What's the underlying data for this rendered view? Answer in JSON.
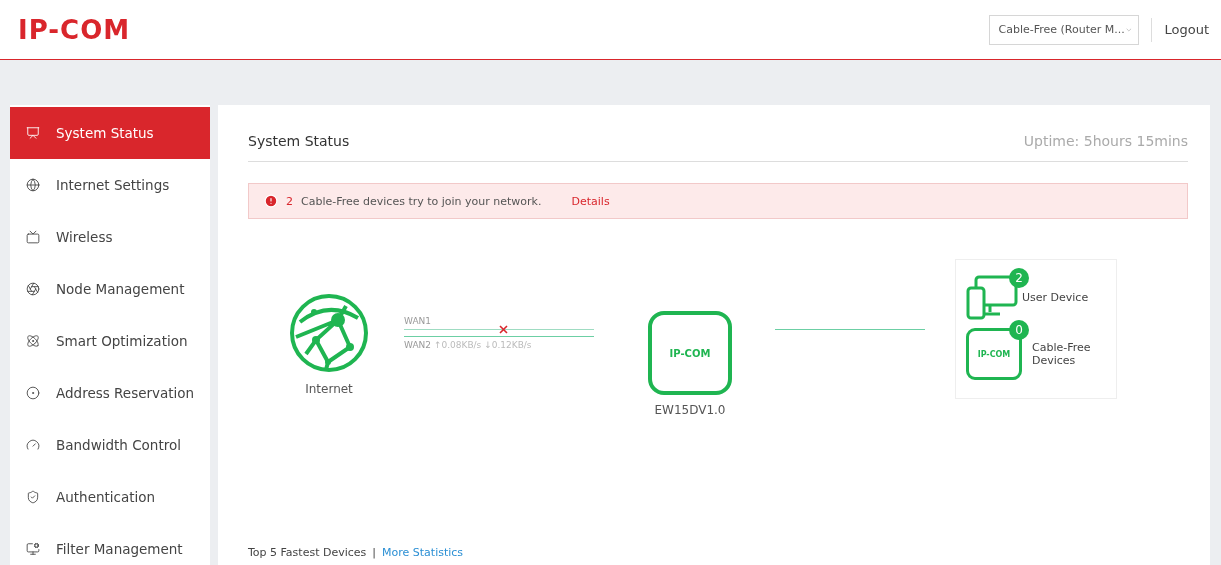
{
  "header": {
    "logo": "IP-COM",
    "mode_select": "Cable-Free (Router M...",
    "logout": "Logout"
  },
  "sidebar": {
    "items": [
      {
        "label": "System Status",
        "selected": true
      },
      {
        "label": "Internet Settings",
        "selected": false
      },
      {
        "label": "Wireless",
        "selected": false
      },
      {
        "label": "Node Management",
        "selected": false
      },
      {
        "label": "Smart Optimization",
        "selected": false
      },
      {
        "label": "Address Reservation",
        "selected": false
      },
      {
        "label": "Bandwidth Control",
        "selected": false
      },
      {
        "label": "Authentication",
        "selected": false
      },
      {
        "label": "Filter Management",
        "selected": false
      }
    ]
  },
  "main": {
    "title": "System Status",
    "uptime": "Uptime: 5hours 15mins",
    "alert": {
      "count": "2",
      "message": "Cable-Free devices try to join your network.",
      "link": "Details"
    },
    "topology": {
      "internet_label": "Internet",
      "wans": [
        {
          "label": "WAN1",
          "connected": false
        },
        {
          "label": "WAN2",
          "connected": true,
          "up": "↑0.08KB/s",
          "down": "↓0.12KB/s"
        }
      ],
      "router_logo": "IP-COM",
      "router_label": "EW15DV1.0",
      "user_devices": {
        "count": "2",
        "label": "User Device"
      },
      "cable_free": {
        "count": "0",
        "logo": "IP-COM",
        "label": "Cable-Free Devices"
      }
    },
    "footer": {
      "title": "Top 5 Fastest Devices",
      "separator": "|",
      "link": "More Statistics"
    }
  }
}
